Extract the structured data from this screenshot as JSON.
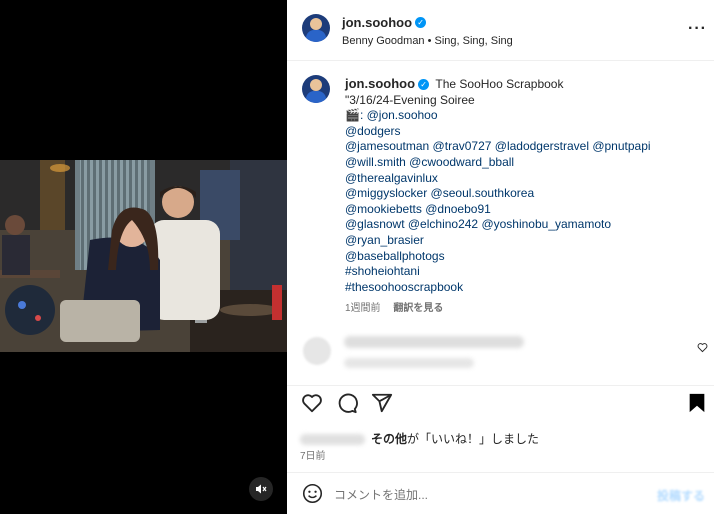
{
  "post": {
    "username": "jon.soohoo",
    "music": "Benny Goodman • Sing, Sing, Sing"
  },
  "caption": {
    "author": "jon.soohoo",
    "lines": [
      {
        "text": "The SooHoo Scrapbook",
        "kind": "title"
      },
      {
        "text": "\"3/16/24-Evening Soiree",
        "kind": "text"
      },
      {
        "text": "🎬: @jon.soohoo",
        "kind": "text"
      },
      {
        "text": "@dodgers",
        "kind": "mention"
      },
      {
        "text": "@jamesoutman @trav0727 @ladodgerstravel @pnutpapi",
        "kind": "mention"
      },
      {
        "text": "@will.smith @cwoodward_bball",
        "kind": "mention"
      },
      {
        "text": "@therealgavinlux",
        "kind": "mention"
      },
      {
        "text": "@miggyslocker @seoul.southkorea",
        "kind": "mention"
      },
      {
        "text": "@mookiebetts @dnoebo91",
        "kind": "mention"
      },
      {
        "text": "@glasnowt @elchino242 @yoshinobu_yamamoto",
        "kind": "mention"
      },
      {
        "text": "@ryan_brasier",
        "kind": "mention"
      },
      {
        "text": "@baseballphotogs",
        "kind": "mention"
      },
      {
        "text": "#shoheiohtani",
        "kind": "mention"
      },
      {
        "text": "#thesoohooscrapbook",
        "kind": "mention"
      }
    ],
    "time_ago": "1週間前",
    "translate_label": "翻訳を見る"
  },
  "likes": {
    "others": "その他",
    "suffix": "が「いいね！」しました"
  },
  "date": "7日前",
  "comment_box": {
    "placeholder": "コメントを追加...",
    "post_label": "投稿する"
  },
  "colors": {
    "verified": "#0095f6",
    "link": "#00376b",
    "muted": "#737373"
  },
  "icons": [
    "verified-badge-icon",
    "more-options-icon",
    "heart-icon",
    "comment-icon",
    "share-icon",
    "bookmark-icon",
    "emoji-icon",
    "mute-icon"
  ]
}
